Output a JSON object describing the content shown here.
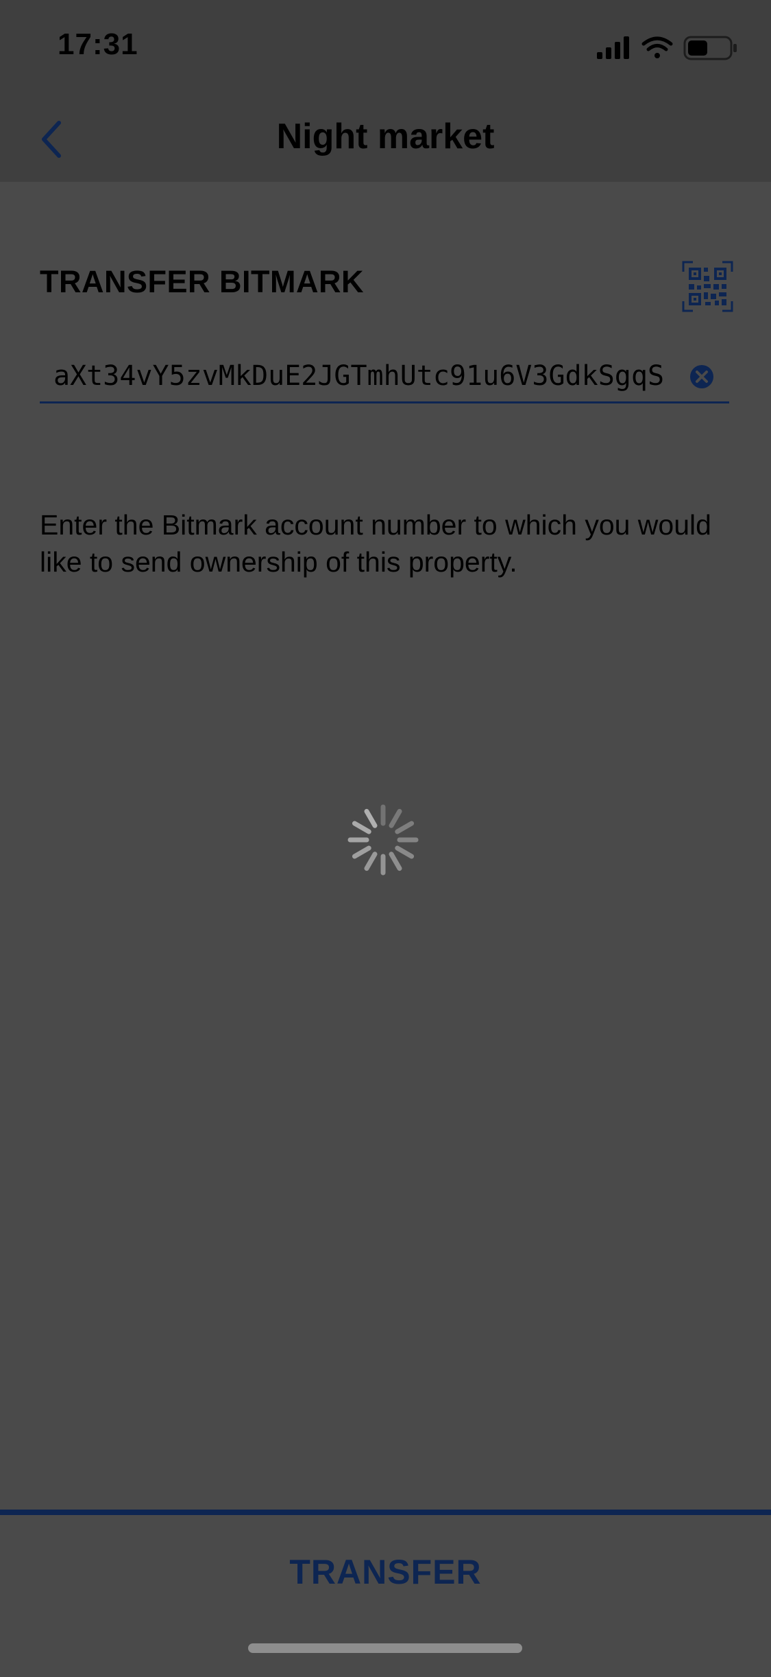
{
  "status_bar": {
    "time": "17:31",
    "icons": [
      "signal-icon",
      "wifi-icon",
      "battery-icon"
    ]
  },
  "nav": {
    "title": "Night market",
    "back_icon": "chevron-left-icon"
  },
  "transfer_section": {
    "title": "TRANSFER BITMARK",
    "qr_icon": "qr-code-icon",
    "address_value": "aXt34vY5zvMkDuE2JGTmhUtc91u6V3GdkSgqS",
    "clear_icon": "clear-icon",
    "instruction": "Enter the Bitmark account number to which you would like to send ownership of this property."
  },
  "loading": {
    "icon": "loading-spinner-icon"
  },
  "footer": {
    "transfer_label": "TRANSFER"
  },
  "colors": {
    "background": "#4a4a4a",
    "bar_background": "#3f3f3f",
    "accent": "#0d2552",
    "text": "#000000"
  }
}
